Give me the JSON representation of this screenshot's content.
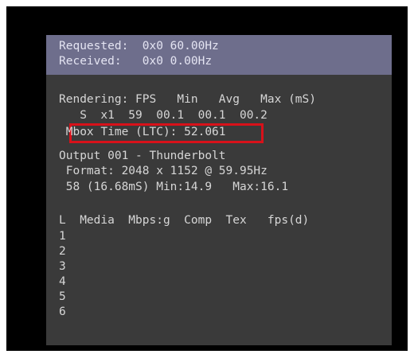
{
  "header": {
    "requested": "Requested:  0x0 60.00Hz",
    "received": "Received:   0x0 0.00Hz"
  },
  "rendering": {
    "columns": "Rendering: FPS   Min   Avg   Max (mS)",
    "values": "   S  x1  59  00.1  00.1  00.2",
    "mbox_time": " Mbox Time (LTC): 52.061"
  },
  "output": {
    "name": "Output 001 - Thunderbolt",
    "format": " Format: 2048 x 1152 @ 59.95Hz",
    "timing": " 58 (16.68mS) Min:14.9   Max:16.1"
  },
  "layers": {
    "header": "L  Media  Mbps:g  Comp  Tex   fps(d)",
    "rows": [
      "1",
      "2",
      "3",
      "4",
      "5",
      "6"
    ]
  },
  "colors": {
    "panel_bg": "#3a3a3a",
    "header_bg": "#6e6e8c",
    "highlight": "#d8111a"
  }
}
